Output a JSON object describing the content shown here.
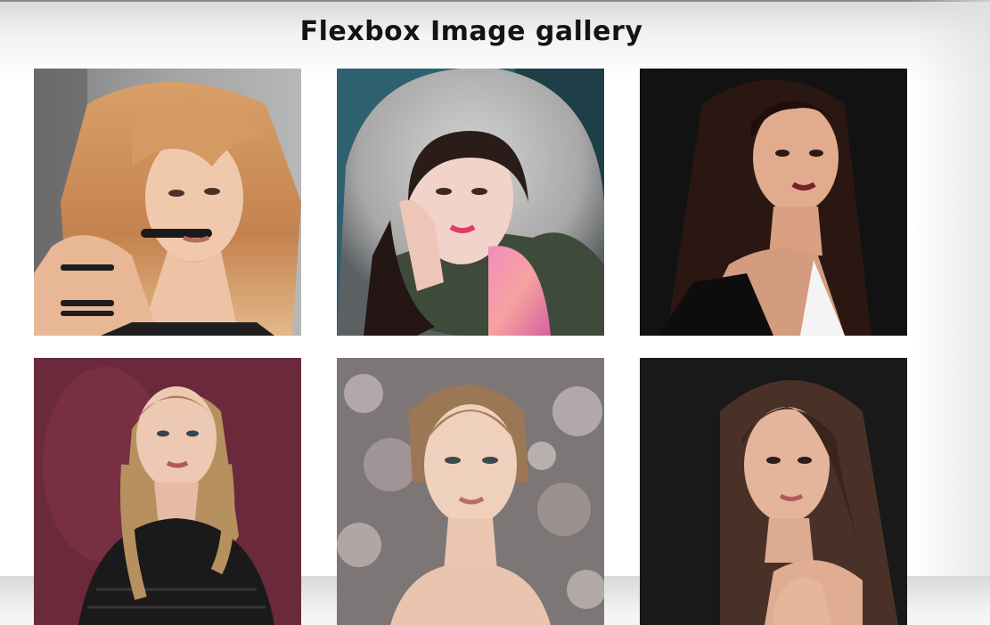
{
  "page": {
    "title": "Flexbox Image gallery"
  },
  "gallery": {
    "images": [
      {
        "subject": "woman with wavy blonde hair and black choker",
        "bg": "#8f8f8f"
      },
      {
        "subject": "woman in fur-trimmed parka hood with pink scarf",
        "bg": "#2b5c6a"
      },
      {
        "subject": "woman with long dark hair on black background",
        "bg": "#111111"
      },
      {
        "subject": "girl with braided hair on burgundy background",
        "bg": "#6e2a3c"
      },
      {
        "subject": "woman with updo hair among blossoms",
        "bg": "#8c8585"
      },
      {
        "subject": "woman with long brown hair on dark background",
        "bg": "#1a1a1a"
      }
    ]
  }
}
